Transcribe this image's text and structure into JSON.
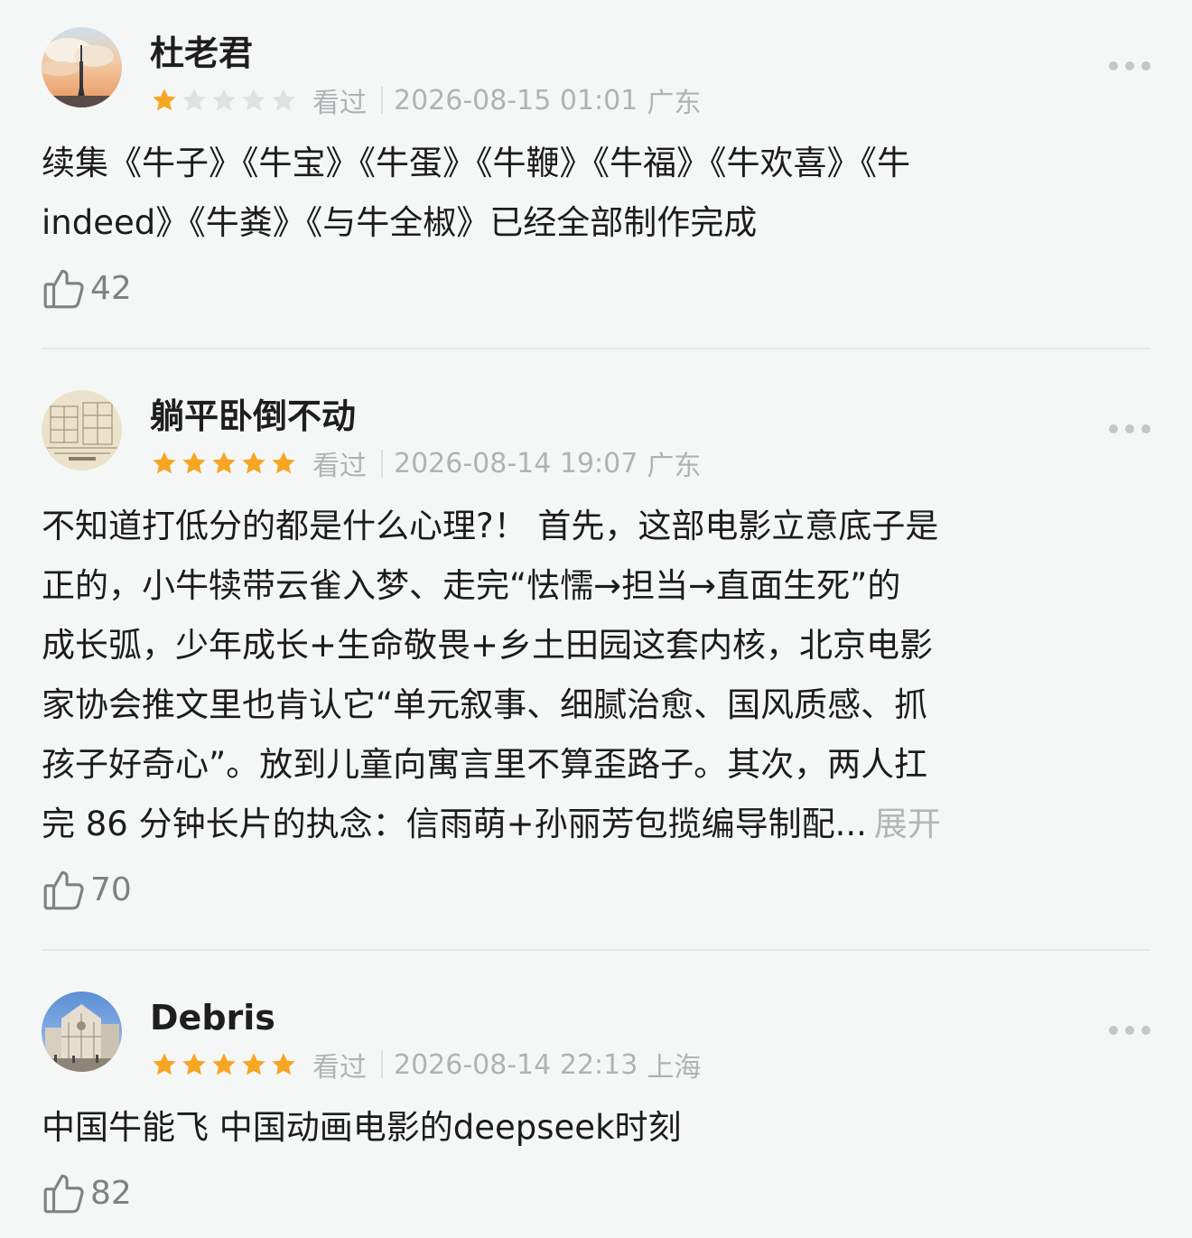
{
  "reviews": [
    {
      "username": "杜老君",
      "rating": 1,
      "watched_label": "看过",
      "datetime": "2026-08-15 01:01",
      "location": "广东",
      "content_lines": [
        "续集《牛子》《牛宝》《牛蛋》《牛鞭》《牛福》《牛欢喜》《牛",
        "indeed》《牛粪》《与牛全椒》已经全部制作完成"
      ],
      "likes": "42",
      "avatar_icon": "tower-sunset-avatar-icon"
    },
    {
      "username": "躺平卧倒不动",
      "rating": 5,
      "watched_label": "看过",
      "datetime": "2026-08-14 19:07",
      "location": "广东",
      "content_lines": [
        "不知道打低分的都是什么心理?！ 首先，这部电影立意底子是",
        "正的，小牛犊带云雀入梦、走完“怯懦→担当→直面生死”的",
        "成长弧，少年成长+生命敬畏+乡土田园这套内核，北京电影",
        "家协会推文里也肯认它“单元叙事、细腻治愈、国风质感、抓",
        "孩子好奇心”。放到儿童向寓言里不算歪路子。其次，两人扛",
        "完 86 分钟长片的执念：信雨萌+孙丽芳包揽编导制配..."
      ],
      "expand_label": "展开",
      "likes": "70",
      "avatar_icon": "sketch-drawing-avatar-icon"
    },
    {
      "username": "Debris",
      "rating": 5,
      "watched_label": "看过",
      "datetime": "2026-08-14 22:13",
      "location": "上海",
      "content_lines": [
        "中国牛能飞 中国动画电影的deepseek时刻"
      ],
      "likes": "82",
      "avatar_icon": "cathedral-avatar-icon"
    }
  ],
  "colors": {
    "star_filled": "#f6a623",
    "star_empty": "#dfe1e2",
    "meta_text": "#b0b3b4",
    "background": "#f5f7f7"
  }
}
